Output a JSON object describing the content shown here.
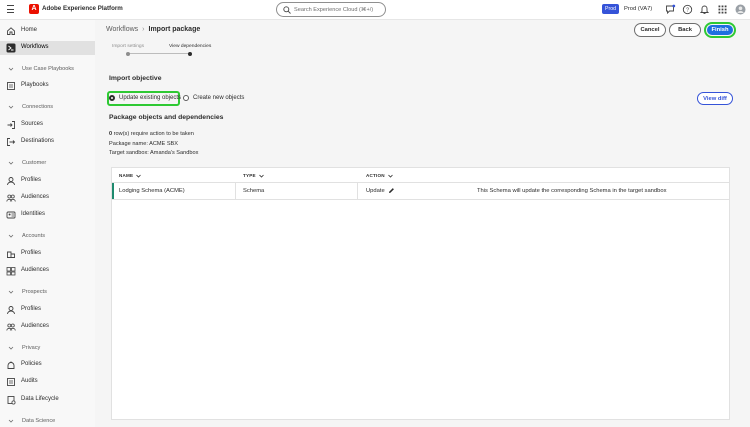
{
  "app": {
    "logo_glyph": "A",
    "title": "Adobe Experience Platform"
  },
  "search": {
    "placeholder": "Search Experience Cloud (⌘+/)"
  },
  "env": {
    "badge": "Prod",
    "name": "Prod (VA7)"
  },
  "sidebar": {
    "home": "Home",
    "workflows": "Workflows",
    "use_case_playbooks": "Use Case Playbooks",
    "playbooks": "Playbooks",
    "connections": "Connections",
    "sources": "Sources",
    "destinations": "Destinations",
    "customer": "Customer",
    "customer_profiles": "Profiles",
    "customer_audiences": "Audiences",
    "identities": "Identities",
    "accounts": "Accounts",
    "accounts_profiles": "Profiles",
    "accounts_audiences": "Audiences",
    "prospects": "Prospects",
    "prospects_profiles": "Profiles",
    "prospects_audiences": "Audiences",
    "privacy": "Privacy",
    "policies": "Policies",
    "audits": "Audits",
    "data_lifecycle": "Data Lifecycle",
    "data_science": "Data Science"
  },
  "breadcrumb": {
    "parent": "Workflows",
    "current": "Import package"
  },
  "actions": {
    "cancel": "Cancel",
    "back": "Back",
    "finish": "Finish"
  },
  "stepper": {
    "step1": "Import settings",
    "step2": "View dependencies"
  },
  "objective": {
    "title": "Import objective",
    "option_update": "Update existing objects",
    "option_create": "Create new objects",
    "selected": "Update existing objects"
  },
  "view_diff": "View diff",
  "package": {
    "title": "Package objects and dependencies",
    "rows_count": "0",
    "rows_text": " row(s) require action to be taken",
    "package_name": "Package name: ACME SBX",
    "target_sandbox": "Target sandbox: Amanda's Sandbox"
  },
  "table": {
    "headers": {
      "name": "NAME",
      "type": "TYPE",
      "action": "ACTION"
    },
    "rows": [
      {
        "name": "Lodging Schema (ACME)",
        "type": "Schema",
        "action": "Update",
        "description": "This Schema will update the corresponding Schema in the target sandbox"
      }
    ]
  },
  "colors": {
    "accent": "#1e6fe0",
    "highlight": "#2ec933",
    "env_badge": "#3553d8",
    "row_marker": "#1e8a6e"
  }
}
